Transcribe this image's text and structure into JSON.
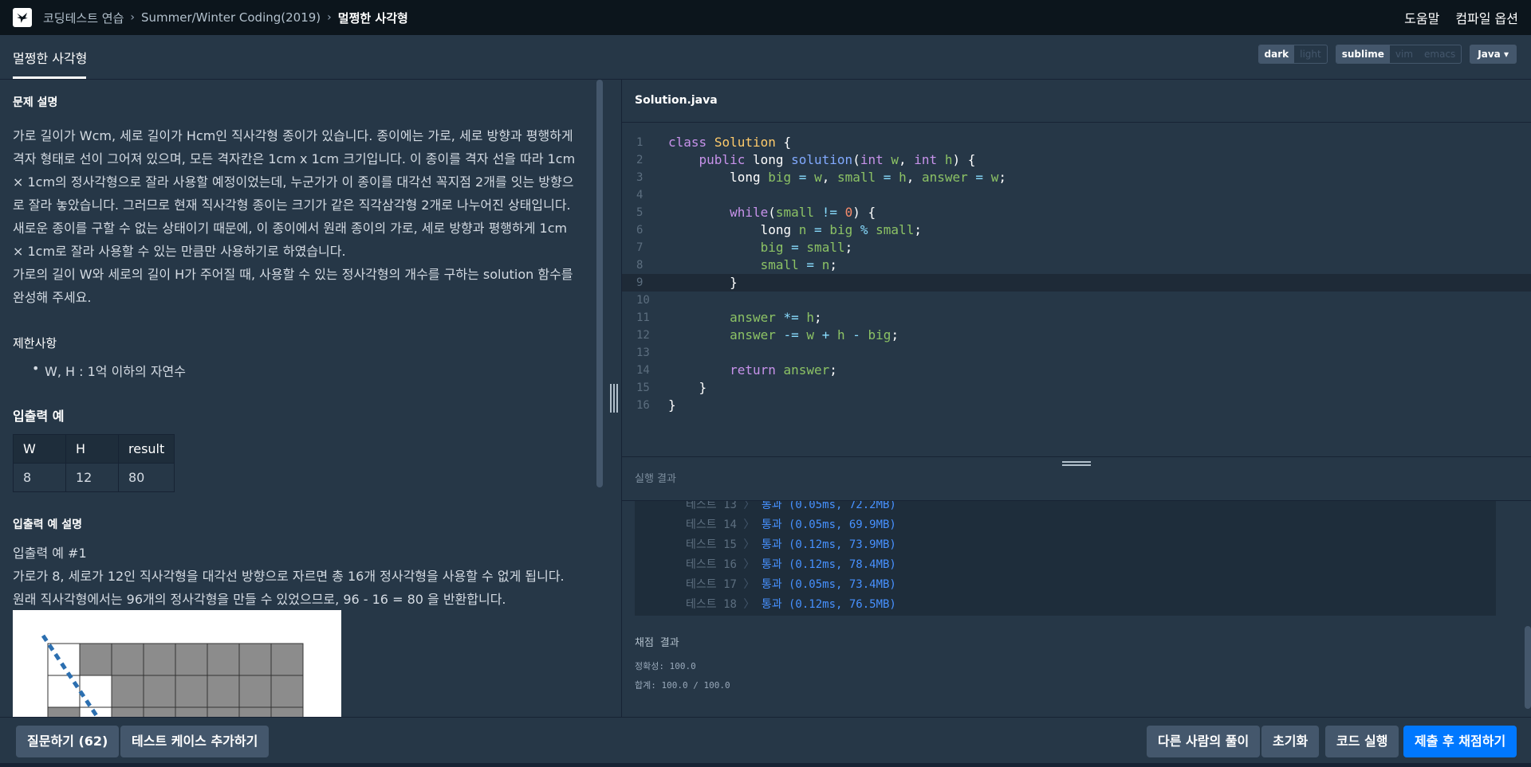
{
  "topbar": {
    "breadcrumbs": [
      "코딩테스트 연습",
      "Summer/Winter Coding(2019)",
      "멀쩡한 사각형"
    ],
    "help": "도움말",
    "compile_options": "컴파일 옵션"
  },
  "tab": {
    "title": "멀쩡한 사각형"
  },
  "toggles": {
    "theme": [
      "dark",
      "light"
    ],
    "keymap": [
      "sublime",
      "vim",
      "emacs"
    ],
    "language": "Java"
  },
  "problem": {
    "desc_title": "문제 설명",
    "desc": [
      "가로 길이가 Wcm, 세로 길이가 Hcm인 직사각형 종이가 있습니다. 종이에는 가로, 세로 방향과 평행하게 격자 형태로 선이 그어져 있으며, 모든 격자칸은 1cm x 1cm 크기입니다. 이 종이를 격자 선을 따라 1cm × 1cm의 정사각형으로 잘라 사용할 예정이었는데, 누군가가 이 종이를 대각선 꼭지점 2개를 잇는 방향으로 잘라 놓았습니다. 그러므로 현재 직사각형 종이는 크기가 같은 직각삼각형 2개로 나누어진 상태입니다. 새로운 종이를 구할 수 없는 상태이기 때문에, 이 종이에서 원래 종이의 가로, 세로 방향과 평행하게 1cm × 1cm로 잘라 사용할 수 있는 만큼만 사용하기로 하였습니다.",
      "가로의 길이 W와 세로의 길이 H가 주어질 때, 사용할 수 있는 정사각형의 개수를 구하는 solution 함수를 완성해 주세요."
    ],
    "constraints_title": "제한사항",
    "constraints": [
      "W, H : 1억 이하의 자연수"
    ],
    "io_title": "입출력 예",
    "io_headers": [
      "W",
      "H",
      "result"
    ],
    "io_rows": [
      [
        "8",
        "12",
        "80"
      ]
    ],
    "io_explain_title": "입출력 예 설명",
    "io_example_label": "입출력 예 #1",
    "io_example_text": "가로가 8, 세로가 12인 직사각형을 대각선 방향으로 자르면 총 16개 정사각형을 사용할 수 없게 됩니다. 원래 직사각형에서는 96개의 정사각형을 만들 수 있었으므로, 96 - 16 = 80 을 반환합니다."
  },
  "editor": {
    "filename": "Solution.java",
    "line_numbers": [
      "1",
      "2",
      "3",
      "4",
      "5",
      "6",
      "7",
      "8",
      "9",
      "10",
      "11",
      "12",
      "13",
      "14",
      "15",
      "16"
    ],
    "lines": [
      "class Solution {",
      "    public long solution(int w, int h) {",
      "        long big = w, small = h, answer = w;",
      "",
      "        while(small != 0) {",
      "            long n = big % small;",
      "            big = small;",
      "            small = n;",
      "        }",
      "",
      "        answer *= h;",
      "        answer -= w + h - big;",
      "",
      "        return answer;",
      "    }",
      "}"
    ]
  },
  "output": {
    "title": "실행 결과",
    "tests": [
      {
        "label": "테스트 13",
        "result": "통과 (0.05ms, 72.2MB)"
      },
      {
        "label": "테스트 14",
        "result": "통과 (0.05ms, 69.9MB)"
      },
      {
        "label": "테스트 15",
        "result": "통과 (0.12ms, 73.9MB)"
      },
      {
        "label": "테스트 16",
        "result": "통과 (0.12ms, 78.4MB)"
      },
      {
        "label": "테스트 17",
        "result": "통과 (0.05ms, 73.4MB)"
      },
      {
        "label": "테스트 18",
        "result": "통과 (0.12ms, 76.5MB)"
      }
    ],
    "grade_title": "채점 결과",
    "accuracy": "정확성: 100.0",
    "total": "합계: 100.0 / 100.0"
  },
  "buttons": {
    "questions": "질문하기 (62)",
    "add_testcase": "테스트 케이스 추가하기",
    "others_solution": "다른 사람의 풀이",
    "reset": "초기화",
    "run": "코드 실행",
    "submit": "제출 후 채점하기"
  }
}
